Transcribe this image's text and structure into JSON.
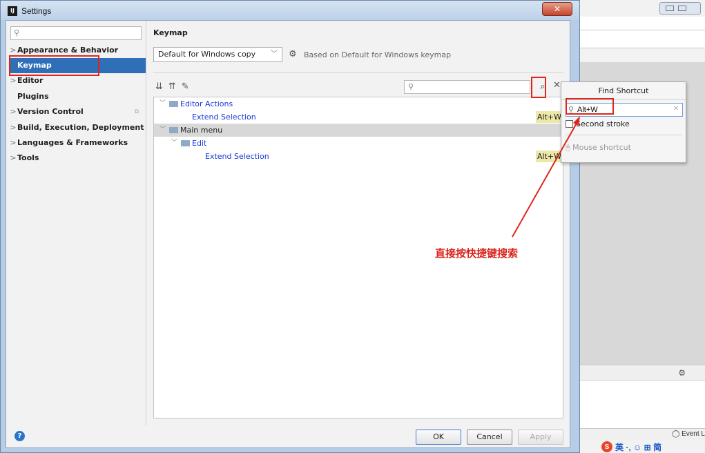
{
  "window": {
    "title": "Settings",
    "close_glyph": "✕"
  },
  "sidebar": {
    "search_placeholder": "",
    "items": [
      {
        "label": "Appearance & Behavior",
        "arrow": ">"
      },
      {
        "label": "Keymap",
        "arrow": ""
      },
      {
        "label": "Editor",
        "arrow": ">"
      },
      {
        "label": "Plugins",
        "arrow": ""
      },
      {
        "label": "Version Control",
        "arrow": ">"
      },
      {
        "label": "Build, Execution, Deployment",
        "arrow": ">"
      },
      {
        "label": "Languages & Frameworks",
        "arrow": ">"
      },
      {
        "label": "Tools",
        "arrow": ">"
      }
    ],
    "selected": "Keymap"
  },
  "content": {
    "title": "Keymap",
    "keymap_select": "Default for Windows copy",
    "based_on": "Based on Default for Windows keymap",
    "filter_placeholder": ""
  },
  "tree": {
    "rows": [
      {
        "label": "Editor Actions",
        "shortcut": ""
      },
      {
        "label": "Extend Selection",
        "shortcut": "Alt+W"
      },
      {
        "label": "Main menu",
        "shortcut": ""
      },
      {
        "label": "Edit",
        "shortcut": ""
      },
      {
        "label": "Extend Selection",
        "shortcut": "Alt+W"
      }
    ]
  },
  "buttons": {
    "ok": "OK",
    "cancel": "Cancel",
    "apply": "Apply",
    "help": "?"
  },
  "find_shortcut": {
    "title": "Find Shortcut",
    "value": "Alt+W",
    "second_stroke": "Second stroke",
    "mouse_shortcut": "Mouse shortcut"
  },
  "background_ide": {
    "event_log": "Event L",
    "ime_text": "英 ·, ☺ ⊞ 简"
  },
  "annotation": {
    "text": "直接按快捷键搜索"
  },
  "colors": {
    "selection": "#2f6fb8",
    "highlight_red": "#e0241b",
    "link_blue": "#1737d4",
    "shortcut_bg": "#ece8a7"
  }
}
